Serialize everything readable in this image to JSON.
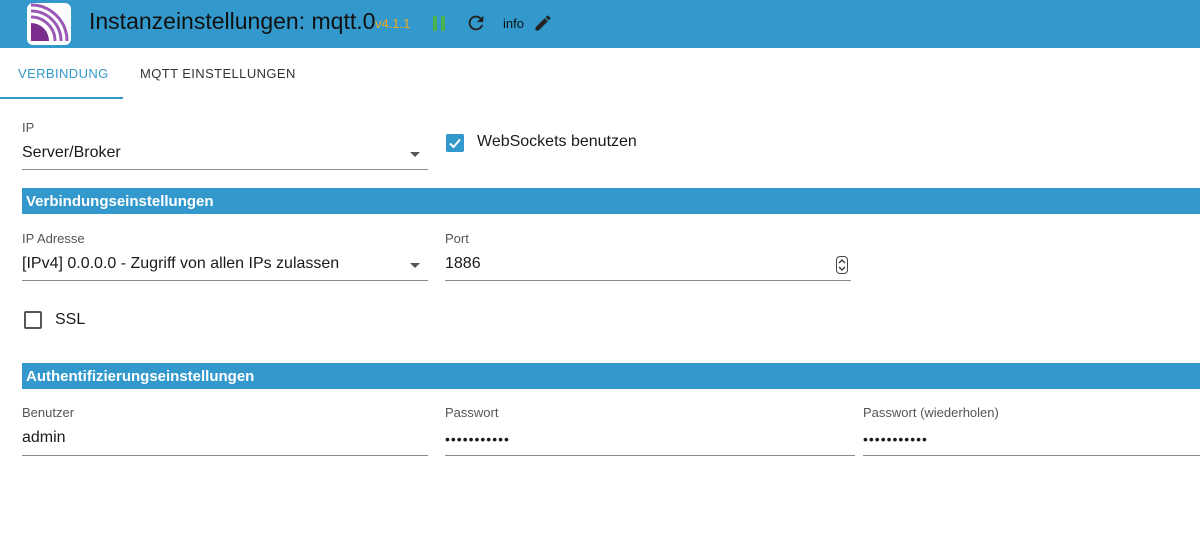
{
  "header": {
    "title": "Instanzeinstellungen: mqtt.0",
    "version": "v4.1.1",
    "info_label": "info",
    "colors": {
      "bar": "#3399cc",
      "version": "#f5a623",
      "pause": "#4caf50"
    }
  },
  "tabs": [
    {
      "label": "VERBINDUNG",
      "active": true
    },
    {
      "label": "MQTT EINSTELLUNGEN",
      "active": false
    }
  ],
  "connection": {
    "ip_label": "IP",
    "ip_value": "Server/Broker",
    "websockets_label": "WebSockets benutzen",
    "websockets_checked": true
  },
  "connection_settings": {
    "title": "Verbindungseinstellungen",
    "ip_address_label": "IP Adresse",
    "ip_address_value": "[IPv4] 0.0.0.0 - Zugriff von allen IPs zulassen",
    "port_label": "Port",
    "port_value": "1886",
    "ssl_label": "SSL",
    "ssl_checked": false
  },
  "auth_settings": {
    "title": "Authentifizierungseinstellungen",
    "user_label": "Benutzer",
    "user_value": "admin",
    "password_label": "Passwort",
    "password_value": "•••••••••••",
    "password_repeat_label": "Passwort (wiederholen)",
    "password_repeat_value": "•••••••••••"
  }
}
